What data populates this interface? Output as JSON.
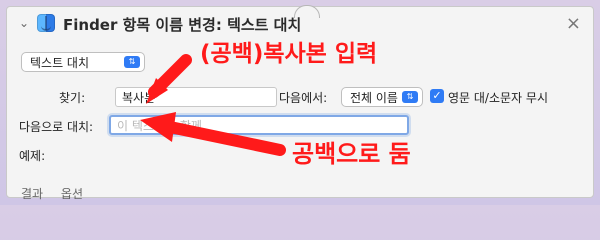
{
  "window": {
    "title": "Finder 항목 이름 변경: 텍스트 대치",
    "close_glyph": "×",
    "collapse_glyph": "⌄"
  },
  "controls": {
    "mode_select": "텍스트 대치",
    "find_label": "찾기:",
    "find_value": "복사본",
    "where_label": "다음에서:",
    "where_select": "전체 이름",
    "ignore_case_label": "영문 대/소문자 무시",
    "replace_label": "다음으로 대치:",
    "replace_placeholder": "이 텍스트와 함께",
    "example_label": "예제:"
  },
  "tabs": [
    "결과",
    "옵션"
  ],
  "annotations": {
    "top_text": "(공백)복사본 입력",
    "bottom_text": "공백으로 둠"
  },
  "colors": {
    "accent_blue": "#2f7bf5",
    "annotation_red": "#ff1a1a"
  }
}
